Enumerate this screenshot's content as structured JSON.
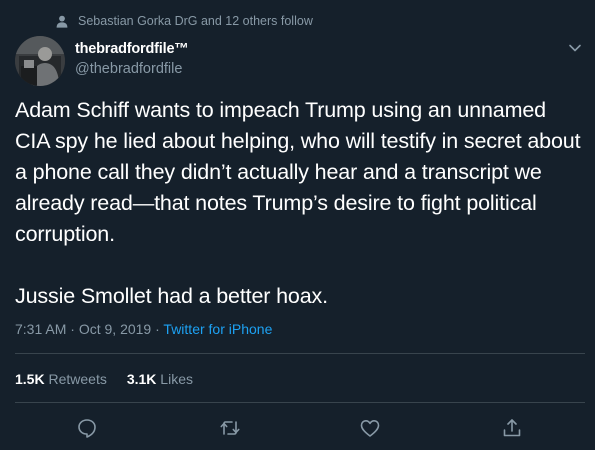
{
  "context": {
    "follow_text": "Sebastian Gorka DrG and 12 others follow",
    "icon": "person-icon"
  },
  "author": {
    "display_name": "thebradfordfile™",
    "handle": "@thebradfordfile"
  },
  "tweet": {
    "text": "Adam Schiff wants to impeach Trump using an unnamed CIA spy he lied about helping, who will testify in secret about a phone call they didn’t actually hear and a transcript we already read—that notes Trump’s desire to fight political corruption.\n\nJussie Smollet had a better hoax.",
    "time": "7:31 AM",
    "separator1": " · ",
    "date": "Oct 9, 2019",
    "separator2": " · ",
    "source": "Twitter for iPhone"
  },
  "stats": {
    "retweets_count": "1.5K",
    "retweets_label": "Retweets",
    "likes_count": "3.1K",
    "likes_label": "Likes"
  },
  "actions": [
    "reply-icon",
    "retweet-icon",
    "like-icon",
    "share-icon"
  ],
  "colors": {
    "background": "#15202b",
    "text_primary": "#ffffff",
    "text_secondary": "#8899a6",
    "link": "#1da1f2",
    "divider": "#38444d"
  }
}
